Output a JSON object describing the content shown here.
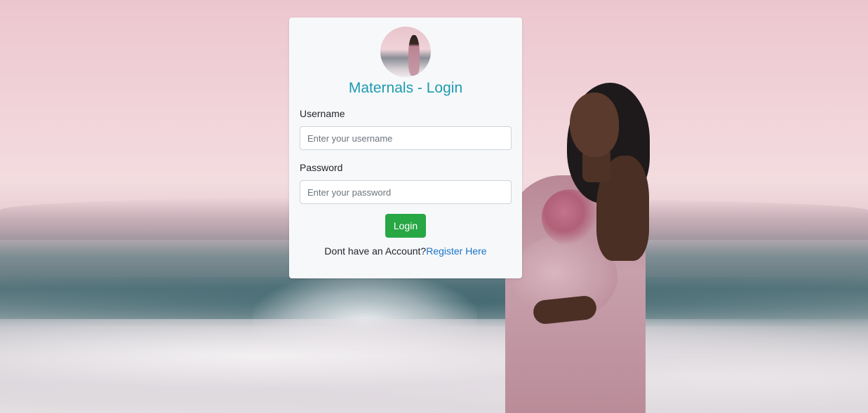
{
  "login": {
    "title": "Maternals - Login",
    "username": {
      "label": "Username",
      "placeholder": "Enter your username",
      "value": ""
    },
    "password": {
      "label": "Password",
      "placeholder": "Enter your password",
      "value": ""
    },
    "submit_label": "Login",
    "footer_text": "Dont have an Account?",
    "register_link": "Register Here"
  },
  "colors": {
    "title": "#1e9bb0",
    "button": "#28a745",
    "link": "#1a73c8",
    "card": "#f7f8fa"
  },
  "icons": {
    "avatar": "maternity-photo-avatar"
  }
}
